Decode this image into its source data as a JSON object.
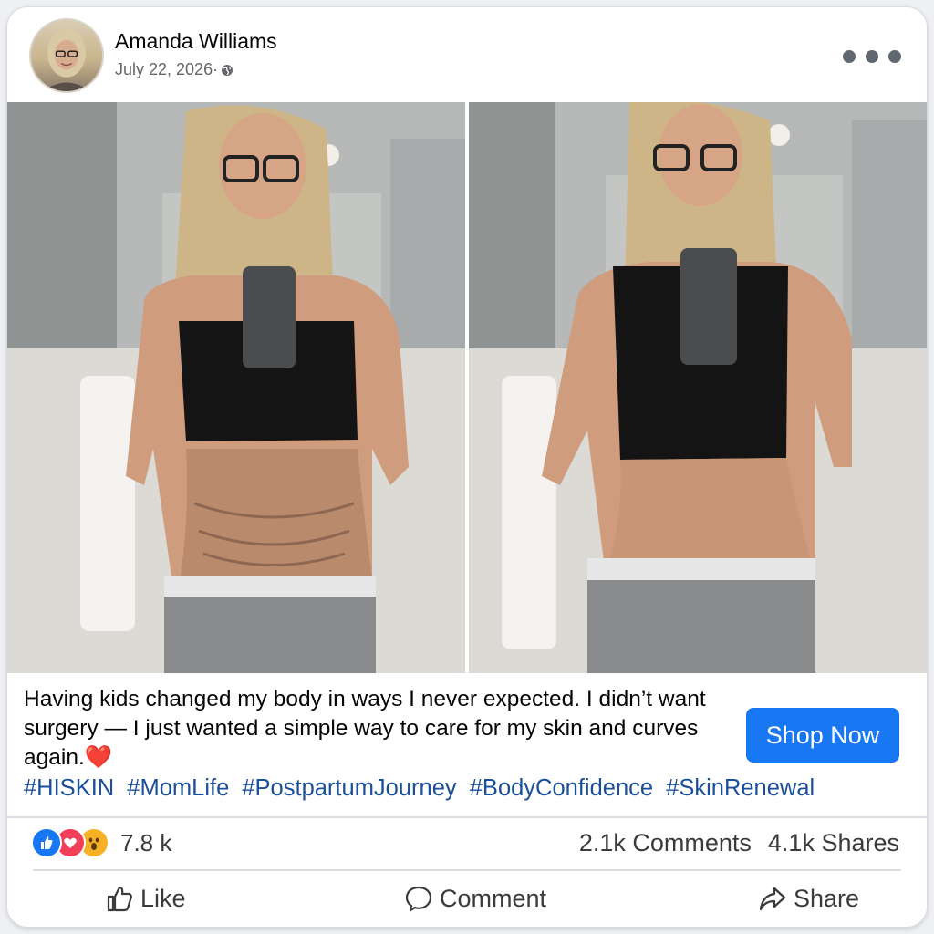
{
  "post": {
    "author": "Amanda Williams",
    "date": "July 22, 2026·",
    "privacy_icon": "globe-icon",
    "menu_icon": "more-options-icon"
  },
  "caption": {
    "text": "Having kids changed my body in ways I never expected. I didn’t want surgery — I just wanted a simple way to care for my skin and curves again.",
    "emoji": "❤️"
  },
  "cta": {
    "label": "Shop Now",
    "color": "#1877f2"
  },
  "hashtags": [
    "#HISKIN",
    "#MomLife",
    "#PostpartumJourney",
    "#BodyConfidence",
    "#SkinRenewal"
  ],
  "stats": {
    "reactions": [
      "like-reaction-icon",
      "love-reaction-icon",
      "wow-reaction-icon"
    ],
    "reaction_count": "7.8 k",
    "comments": "2.1k Comments",
    "shares": "4.1k Shares"
  },
  "actions": {
    "like": "Like",
    "comment": "Comment",
    "share": "Share"
  },
  "colors": {
    "link": "#1b4f9a",
    "heart": "#e41e3f"
  }
}
